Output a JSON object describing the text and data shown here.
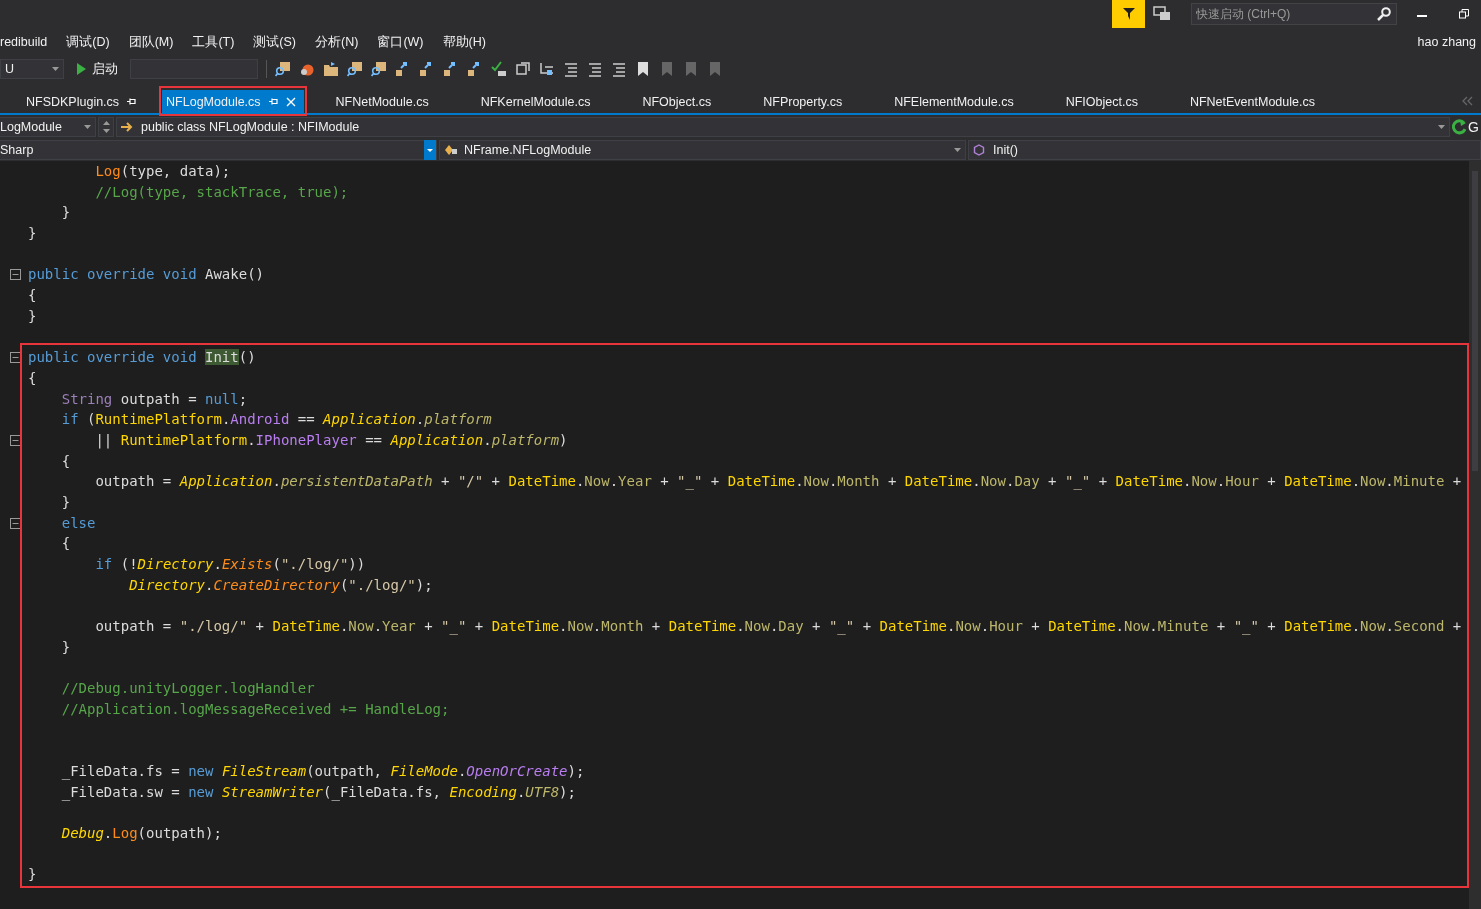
{
  "menu": [
    "redibuild",
    "调试(D)",
    "团队(M)",
    "工具(T)",
    "测试(S)",
    "分析(N)",
    "窗口(W)",
    "帮助(H)"
  ],
  "quick_launch": {
    "placeholder": "快速启动 (Ctrl+Q)"
  },
  "user": "hao zhang",
  "toolbar": {
    "config": "U",
    "start": "启动"
  },
  "tabs": [
    {
      "label": "NFSDKPlugin.cs",
      "selected": false,
      "pinned": true,
      "marked": false
    },
    {
      "label": "NFLogModule.cs",
      "selected": true,
      "pinned": true,
      "marked": true
    },
    {
      "label": "NFNetModule.cs",
      "selected": false,
      "pinned": false,
      "marked": false
    },
    {
      "label": "NFKernelModule.cs",
      "selected": false,
      "pinned": false,
      "marked": false
    },
    {
      "label": "NFObject.cs",
      "selected": false,
      "pinned": false,
      "marked": false
    },
    {
      "label": "NFProperty.cs",
      "selected": false,
      "pinned": false,
      "marked": false
    },
    {
      "label": "NFElementModule.cs",
      "selected": false,
      "pinned": false,
      "marked": false
    },
    {
      "label": "NFIObject.cs",
      "selected": false,
      "pinned": false,
      "marked": false
    },
    {
      "label": "NFNetEventModule.cs",
      "selected": false,
      "pinned": false,
      "marked": false
    }
  ],
  "nav": {
    "project": "LogModule",
    "type": "public class NFLogModule : NFIModule",
    "cut_button": "G",
    "language": "Sharp",
    "namespace": "NFrame.NFLogModule",
    "member": "Init()"
  },
  "editor": {
    "lines": [
      {
        "kind": "code",
        "fold": false,
        "tokens": [
          {
            "kind": "method",
            "text": "        Log"
          },
          {
            "kind": "plain",
            "text": "(type, data);"
          }
        ]
      },
      {
        "kind": "code",
        "fold": false,
        "tokens": [
          {
            "kind": "comment",
            "text": "        //Log(type, stackTrace, true);"
          }
        ]
      },
      {
        "kind": "code",
        "fold": false,
        "tokens": [
          {
            "kind": "plain",
            "text": "    }"
          }
        ]
      },
      {
        "kind": "code",
        "fold": false,
        "tokens": [
          {
            "kind": "plain",
            "text": "}"
          }
        ]
      },
      {
        "kind": "blank"
      },
      {
        "kind": "code",
        "fold": true,
        "tokens": [
          {
            "kind": "keyword",
            "text": "public override void"
          },
          {
            "kind": "plain",
            "text": " Awake()"
          }
        ]
      },
      {
        "kind": "code",
        "fold": false,
        "tokens": [
          {
            "kind": "plain",
            "text": "{"
          }
        ]
      },
      {
        "kind": "code",
        "fold": false,
        "tokens": [
          {
            "kind": "plain",
            "text": "}"
          }
        ]
      },
      {
        "kind": "blank"
      }
    ],
    "marked_block": {
      "lines": [
        {
          "kind": "code",
          "fold": true,
          "tokens": [
            {
              "kind": "keyword",
              "text": "public override void "
            },
            {
              "kind": "match",
              "text": "Init"
            },
            {
              "kind": "plain",
              "text": "()"
            }
          ]
        },
        {
          "kind": "code",
          "fold": false,
          "tokens": [
            {
              "kind": "plain",
              "text": "{"
            }
          ]
        },
        {
          "kind": "code",
          "fold": false,
          "tokens": [
            {
              "kind": "type",
              "text": "    String"
            },
            {
              "kind": "plain",
              "text": " outpath = "
            },
            {
              "kind": "keyword",
              "text": "null"
            },
            {
              "kind": "plain",
              "text": ";"
            }
          ]
        },
        {
          "kind": "code",
          "fold": false,
          "tokens": [
            {
              "kind": "keyword",
              "text": "    if"
            },
            {
              "kind": "plain",
              "text": " ("
            },
            {
              "kind": "class",
              "text": "RuntimePlatform"
            },
            {
              "kind": "plain",
              "text": "."
            },
            {
              "kind": "enum",
              "text": "Android"
            },
            {
              "kind": "plain",
              "text": " == "
            },
            {
              "kind": "class-italic",
              "text": "Application"
            },
            {
              "kind": "plain",
              "text": "."
            },
            {
              "kind": "property-italic",
              "text": "platform"
            }
          ]
        },
        {
          "kind": "code",
          "fold": true,
          "tokens": [
            {
              "kind": "plain",
              "text": "        || "
            },
            {
              "kind": "class",
              "text": "RuntimePlatform"
            },
            {
              "kind": "plain",
              "text": "."
            },
            {
              "kind": "enum",
              "text": "IPhonePlayer"
            },
            {
              "kind": "plain",
              "text": " == "
            },
            {
              "kind": "class-italic",
              "text": "Application"
            },
            {
              "kind": "plain",
              "text": "."
            },
            {
              "kind": "property-italic",
              "text": "platform"
            },
            {
              "kind": "plain",
              "text": ")"
            }
          ]
        },
        {
          "kind": "code",
          "fold": false,
          "tokens": [
            {
              "kind": "plain",
              "text": "    {"
            }
          ]
        },
        {
          "kind": "code",
          "fold": false,
          "tokens": [
            {
              "kind": "plain",
              "text": "        outpath = "
            },
            {
              "kind": "class-italic",
              "text": "Application"
            },
            {
              "kind": "plain",
              "text": "."
            },
            {
              "kind": "property-italic",
              "text": "persistentDataPath"
            },
            {
              "kind": "plain",
              "text": " + "
            },
            {
              "kind": "string",
              "text": "\"/\""
            },
            {
              "kind": "plain",
              "text": " + "
            },
            {
              "kind": "class",
              "text": "DateTime"
            },
            {
              "kind": "plain",
              "text": "."
            },
            {
              "kind": "property",
              "text": "Now"
            },
            {
              "kind": "plain",
              "text": "."
            },
            {
              "kind": "property",
              "text": "Year"
            },
            {
              "kind": "plain",
              "text": " + "
            },
            {
              "kind": "string",
              "text": "\"_\""
            },
            {
              "kind": "plain",
              "text": " + "
            },
            {
              "kind": "class",
              "text": "DateTime"
            },
            {
              "kind": "plain",
              "text": "."
            },
            {
              "kind": "property",
              "text": "Now"
            },
            {
              "kind": "plain",
              "text": "."
            },
            {
              "kind": "property",
              "text": "Month"
            },
            {
              "kind": "plain",
              "text": " + "
            },
            {
              "kind": "class",
              "text": "DateTime"
            },
            {
              "kind": "plain",
              "text": "."
            },
            {
              "kind": "property",
              "text": "Now"
            },
            {
              "kind": "plain",
              "text": "."
            },
            {
              "kind": "property",
              "text": "Day"
            },
            {
              "kind": "plain",
              "text": " + "
            },
            {
              "kind": "string",
              "text": "\"_\""
            },
            {
              "kind": "plain",
              "text": " + "
            },
            {
              "kind": "class",
              "text": "DateTime"
            },
            {
              "kind": "plain",
              "text": "."
            },
            {
              "kind": "property",
              "text": "Now"
            },
            {
              "kind": "plain",
              "text": "."
            },
            {
              "kind": "property",
              "text": "Hour"
            },
            {
              "kind": "plain",
              "text": " + "
            },
            {
              "kind": "class",
              "text": "DateTime"
            },
            {
              "kind": "plain",
              "text": "."
            },
            {
              "kind": "property",
              "text": "Now"
            },
            {
              "kind": "plain",
              "text": "."
            },
            {
              "kind": "property",
              "text": "Minute"
            },
            {
              "kind": "plain",
              "text": " +"
            }
          ]
        },
        {
          "kind": "code",
          "fold": false,
          "tokens": [
            {
              "kind": "plain",
              "text": "    }"
            }
          ]
        },
        {
          "kind": "code",
          "fold": true,
          "tokens": [
            {
              "kind": "keyword",
              "text": "    else"
            }
          ]
        },
        {
          "kind": "code",
          "fold": false,
          "tokens": [
            {
              "kind": "plain",
              "text": "    {"
            }
          ]
        },
        {
          "kind": "code",
          "fold": false,
          "tokens": [
            {
              "kind": "keyword",
              "text": "        if"
            },
            {
              "kind": "plain",
              "text": " (!"
            },
            {
              "kind": "class-italic",
              "text": "Directory"
            },
            {
              "kind": "plain",
              "text": "."
            },
            {
              "kind": "method-italic",
              "text": "Exists"
            },
            {
              "kind": "plain",
              "text": "("
            },
            {
              "kind": "string",
              "text": "\"./log/\""
            },
            {
              "kind": "plain",
              "text": "))"
            }
          ]
        },
        {
          "kind": "code",
          "fold": false,
          "tokens": [
            {
              "kind": "class-italic",
              "text": "            Directory"
            },
            {
              "kind": "plain",
              "text": "."
            },
            {
              "kind": "method-italic",
              "text": "CreateDirectory"
            },
            {
              "kind": "plain",
              "text": "("
            },
            {
              "kind": "string",
              "text": "\"./log/\""
            },
            {
              "kind": "plain",
              "text": ");"
            }
          ]
        },
        {
          "kind": "blank"
        },
        {
          "kind": "code",
          "fold": false,
          "tokens": [
            {
              "kind": "plain",
              "text": "        outpath = "
            },
            {
              "kind": "string",
              "text": "\"./log/\""
            },
            {
              "kind": "plain",
              "text": " + "
            },
            {
              "kind": "class",
              "text": "DateTime"
            },
            {
              "kind": "plain",
              "text": "."
            },
            {
              "kind": "property",
              "text": "Now"
            },
            {
              "kind": "plain",
              "text": "."
            },
            {
              "kind": "property",
              "text": "Year"
            },
            {
              "kind": "plain",
              "text": " + "
            },
            {
              "kind": "string",
              "text": "\"_\""
            },
            {
              "kind": "plain",
              "text": " + "
            },
            {
              "kind": "class",
              "text": "DateTime"
            },
            {
              "kind": "plain",
              "text": "."
            },
            {
              "kind": "property",
              "text": "Now"
            },
            {
              "kind": "plain",
              "text": "."
            },
            {
              "kind": "property",
              "text": "Month"
            },
            {
              "kind": "plain",
              "text": " + "
            },
            {
              "kind": "class",
              "text": "DateTime"
            },
            {
              "kind": "plain",
              "text": "."
            },
            {
              "kind": "property",
              "text": "Now"
            },
            {
              "kind": "plain",
              "text": "."
            },
            {
              "kind": "property",
              "text": "Day"
            },
            {
              "kind": "plain",
              "text": " + "
            },
            {
              "kind": "string",
              "text": "\"_\""
            },
            {
              "kind": "plain",
              "text": " + "
            },
            {
              "kind": "class",
              "text": "DateTime"
            },
            {
              "kind": "plain",
              "text": "."
            },
            {
              "kind": "property",
              "text": "Now"
            },
            {
              "kind": "plain",
              "text": "."
            },
            {
              "kind": "property",
              "text": "Hour"
            },
            {
              "kind": "plain",
              "text": " + "
            },
            {
              "kind": "class",
              "text": "DateTime"
            },
            {
              "kind": "plain",
              "text": "."
            },
            {
              "kind": "property",
              "text": "Now"
            },
            {
              "kind": "plain",
              "text": "."
            },
            {
              "kind": "property",
              "text": "Minute"
            },
            {
              "kind": "plain",
              "text": " + "
            },
            {
              "kind": "string",
              "text": "\"_\""
            },
            {
              "kind": "plain",
              "text": " + "
            },
            {
              "kind": "class",
              "text": "DateTime"
            },
            {
              "kind": "plain",
              "text": "."
            },
            {
              "kind": "property",
              "text": "Now"
            },
            {
              "kind": "plain",
              "text": "."
            },
            {
              "kind": "property",
              "text": "Second"
            },
            {
              "kind": "plain",
              "text": " +"
            }
          ]
        },
        {
          "kind": "code",
          "fold": false,
          "tokens": [
            {
              "kind": "plain",
              "text": "    }"
            }
          ]
        },
        {
          "kind": "blank"
        },
        {
          "kind": "code",
          "fold": false,
          "tokens": [
            {
              "kind": "comment",
              "text": "    //Debug.unityLogger.logHandler"
            }
          ]
        },
        {
          "kind": "code",
          "fold": false,
          "tokens": [
            {
              "kind": "comment",
              "text": "    //Application.logMessageReceived += HandleLog;"
            }
          ]
        },
        {
          "kind": "blank"
        },
        {
          "kind": "blank"
        },
        {
          "kind": "code",
          "fold": false,
          "tokens": [
            {
              "kind": "plain",
              "text": "    _FileData.fs = "
            },
            {
              "kind": "keyword",
              "text": "new "
            },
            {
              "kind": "class-italic",
              "text": "FileStream"
            },
            {
              "kind": "plain",
              "text": "(outpath, "
            },
            {
              "kind": "class-italic",
              "text": "FileMode"
            },
            {
              "kind": "plain",
              "text": "."
            },
            {
              "kind": "enum-italic",
              "text": "OpenOrCreate"
            },
            {
              "kind": "plain",
              "text": ");"
            }
          ]
        },
        {
          "kind": "code",
          "fold": false,
          "tokens": [
            {
              "kind": "plain",
              "text": "    _FileData.sw = "
            },
            {
              "kind": "keyword",
              "text": "new "
            },
            {
              "kind": "class-italic",
              "text": "StreamWriter"
            },
            {
              "kind": "plain",
              "text": "(_FileData.fs, "
            },
            {
              "kind": "class-italic",
              "text": "Encoding"
            },
            {
              "kind": "plain",
              "text": "."
            },
            {
              "kind": "property-italic",
              "text": "UTF8"
            },
            {
              "kind": "plain",
              "text": ");"
            }
          ]
        },
        {
          "kind": "blank"
        },
        {
          "kind": "code",
          "fold": false,
          "tokens": [
            {
              "kind": "class-italic",
              "text": "    Debug"
            },
            {
              "kind": "plain",
              "text": "."
            },
            {
              "kind": "method",
              "text": "Log"
            },
            {
              "kind": "plain",
              "text": "(outpath);"
            }
          ]
        },
        {
          "kind": "blank"
        },
        {
          "kind": "code",
          "fold": false,
          "tokens": [
            {
              "kind": "plain",
              "text": "}"
            }
          ]
        }
      ]
    }
  }
}
